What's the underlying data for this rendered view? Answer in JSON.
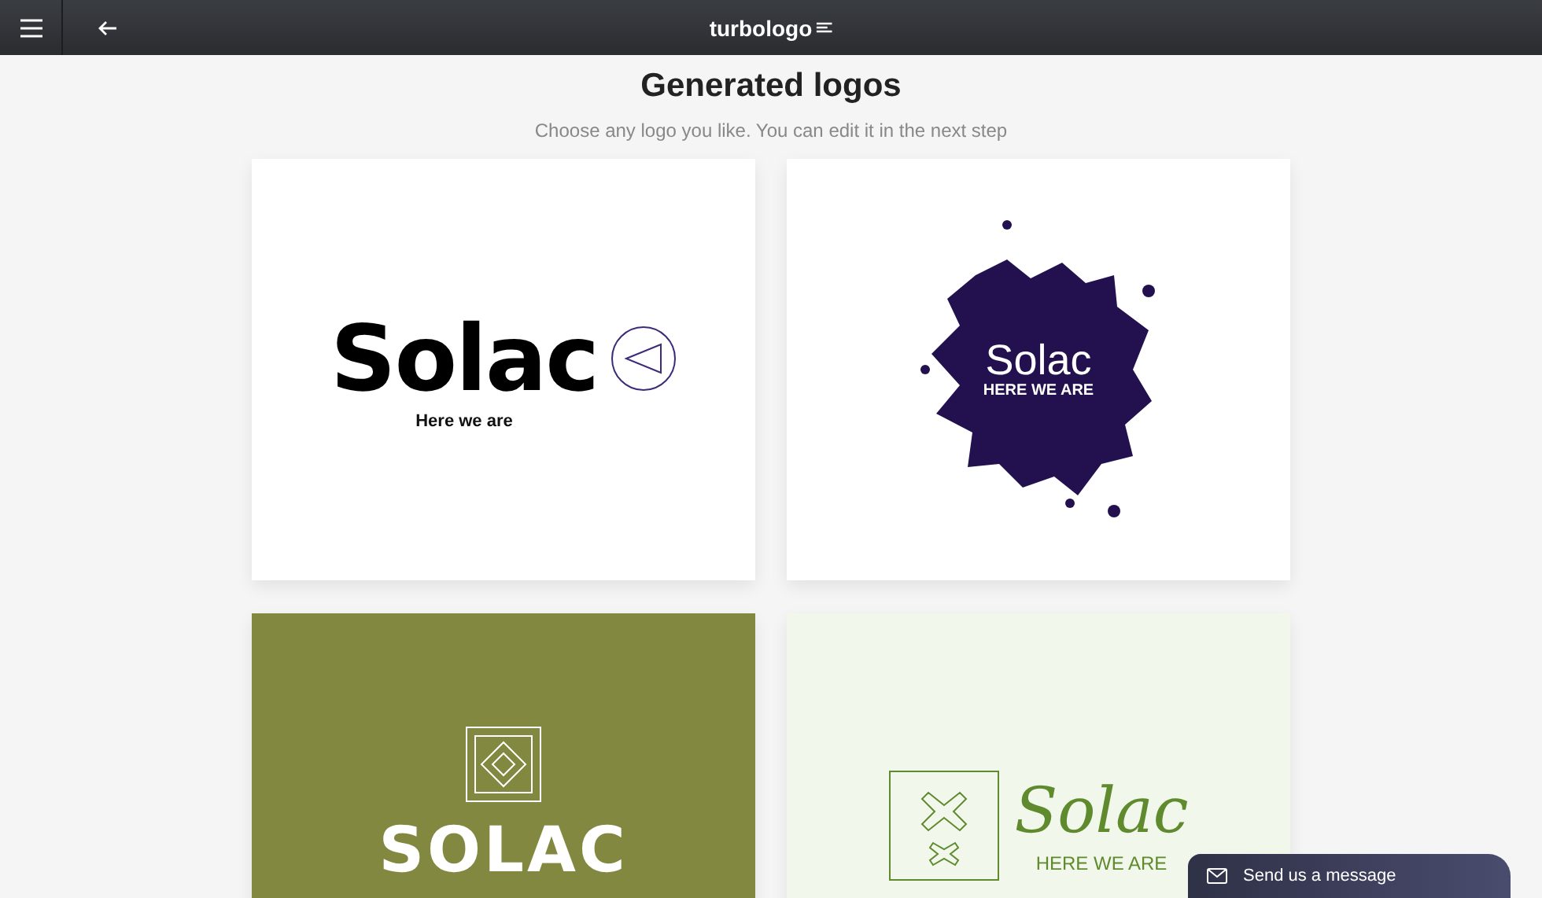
{
  "header": {
    "logo": "turbologo"
  },
  "page": {
    "title": "Generated logos",
    "subtitle": "Choose any logo you like. You can edit it in the next step"
  },
  "logos": [
    {
      "kind": "hand",
      "name": "Solac",
      "tagline": "Here we are"
    },
    {
      "kind": "splash",
      "name": "Solac",
      "tagline": "HERE WE ARE"
    },
    {
      "kind": "badge",
      "name": "SOLAC"
    },
    {
      "kind": "script",
      "name": "Solac",
      "tagline": "HERE WE ARE"
    }
  ],
  "chat": {
    "label": "Send us a message"
  }
}
